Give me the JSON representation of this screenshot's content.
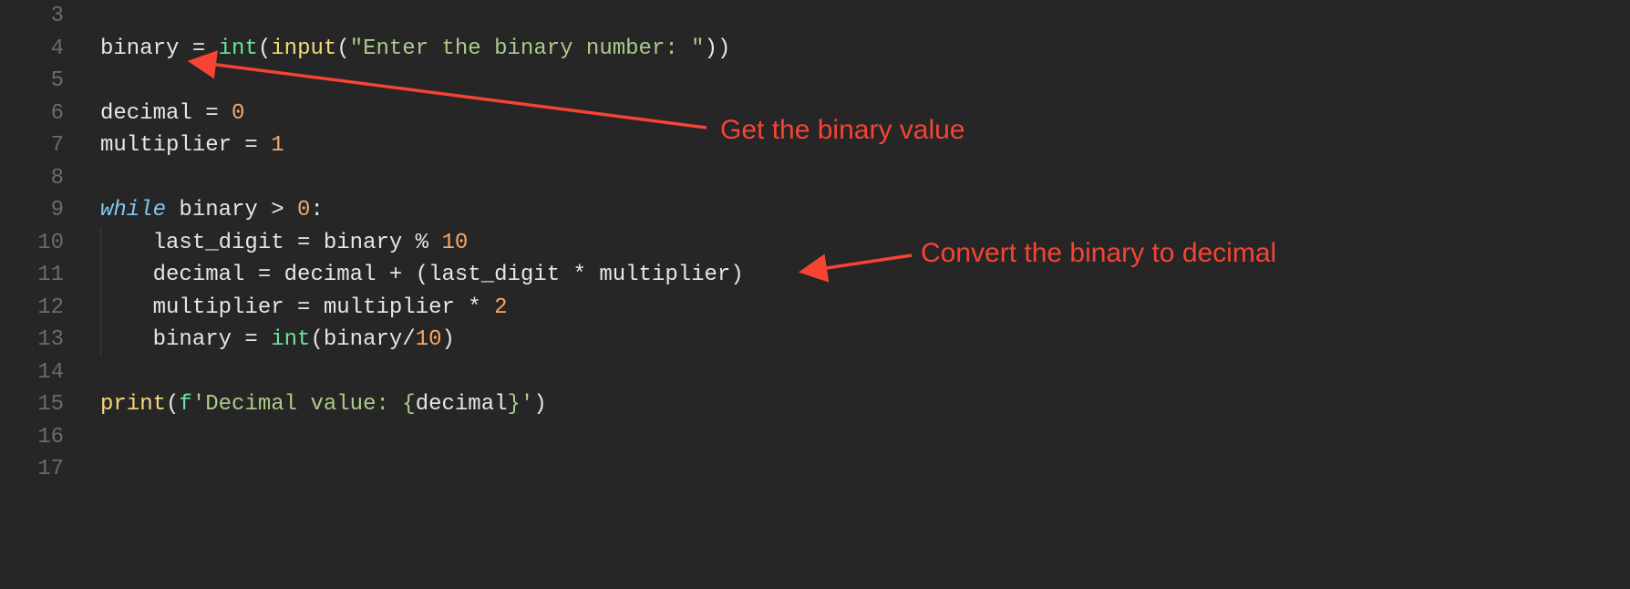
{
  "gutter": {
    "3": "3",
    "4": "4",
    "5": "5",
    "6": "6",
    "7": "7",
    "8": "8",
    "9": "9",
    "10": "10",
    "11": "11",
    "12": "12",
    "13": "13",
    "14": "14",
    "15": "15",
    "16": "16",
    "17": "17"
  },
  "code": {
    "l4": {
      "var": "binary",
      "eq": " = ",
      "int": "int",
      "lp1": "(",
      "input": "input",
      "lp2": "(",
      "str": "\"Enter the binary number: \"",
      "rp2": ")",
      "rp1": ")"
    },
    "l6": {
      "var": "decimal",
      "eq": " = ",
      "num": "0"
    },
    "l7": {
      "var": "multiplier",
      "eq": " = ",
      "num": "1"
    },
    "l9": {
      "while": "while",
      "sp": " ",
      "cond": "binary > ",
      "num": "0",
      "colon": ":"
    },
    "l10": {
      "indent": "    ",
      "var": "last_digit",
      "eq": " = ",
      "rhs1": "binary % ",
      "num": "10"
    },
    "l11": {
      "indent": "    ",
      "var": "decimal",
      "eq": " = ",
      "rhs": "decimal + (last_digit * multiplier)"
    },
    "l12": {
      "indent": "    ",
      "var": "multiplier",
      "eq": " = ",
      "rhs1": "multiplier * ",
      "num": "2"
    },
    "l13": {
      "indent": "    ",
      "var": "binary",
      "eq": " = ",
      "int": "int",
      "lp": "(",
      "arg1": "binary",
      "slash": "/",
      "num": "10",
      "rp": ")"
    },
    "l15": {
      "print": "print",
      "lp": "(",
      "fprefix": "f",
      "str_open": "'",
      "str_a": "Decimal value: ",
      "brace_l": "{",
      "interp": "decimal",
      "brace_r": "}",
      "str_close": "'",
      "rp": ")"
    }
  },
  "annotations": {
    "a1": "Get the binary value",
    "a2": "Convert the binary to decimal"
  }
}
